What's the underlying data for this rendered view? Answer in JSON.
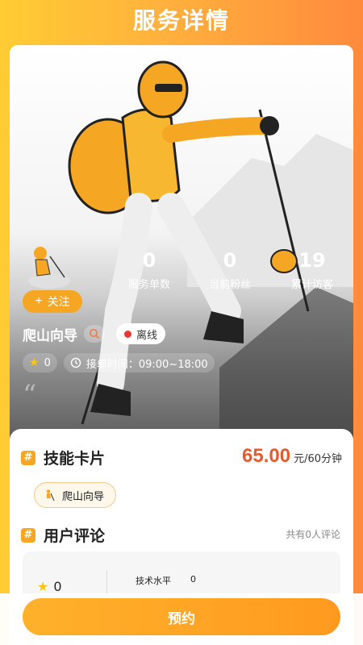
{
  "header": {
    "title": "服务详情"
  },
  "profile": {
    "follow_label": "关注",
    "name": "爬山向导",
    "status": "离线",
    "rating": "0",
    "hours": "接单时间：09:00~18:00",
    "quote": "“"
  },
  "stats": [
    {
      "value": "0",
      "label": "服务单数"
    },
    {
      "value": "0",
      "label": "当前粉丝"
    },
    {
      "value": "19",
      "label": "累计访客"
    }
  ],
  "skill": {
    "section_title": "技能卡片",
    "price": "65.00",
    "unit": "元/60分钟",
    "tag": "爬山向导"
  },
  "reviews": {
    "section_title": "用户评论",
    "count_text": "共有0人评论",
    "score": "0",
    "item_label": "技术水平",
    "item_value": "0"
  },
  "actions": {
    "book_label": "预约"
  },
  "colors": {
    "accent": "#f5a623",
    "price": "#e65a2f",
    "offline": "#e53935"
  }
}
